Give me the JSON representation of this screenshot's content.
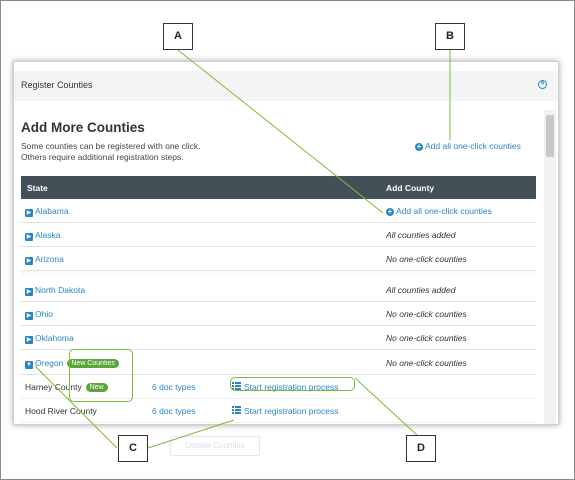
{
  "modal": {
    "title": "Register Counties",
    "close_icon": "close-circle-icon",
    "section_title": "Add More Counties",
    "desc_line1": "Some counties can be registered with one click.",
    "desc_line2": "Others require additional registration steps.",
    "add_all_label": "Add all one-click counties",
    "footer_button": "Update Counties"
  },
  "table": {
    "headers": {
      "state": "State",
      "add_county": "Add County"
    },
    "rows": [
      {
        "state": "Alabama",
        "add": "Add all one-click counties"
      },
      {
        "state": "Alaska",
        "add": "All counties added"
      },
      {
        "state": "Arizona",
        "add": "No one-click counties"
      },
      {
        "state": "North Dakota",
        "add": "All counties added"
      },
      {
        "state": "Ohio",
        "add": "No one-click counties"
      },
      {
        "state": "Oklahoma",
        "add": "No one-click counties"
      },
      {
        "state": "Oregon",
        "badge": "New Counties",
        "add": "No one-click counties"
      }
    ],
    "sub_rows": [
      {
        "county": "Harney County",
        "badge": "New",
        "doc_types": "6 doc types",
        "start": "Start registration process"
      },
      {
        "county": "Hood River County",
        "doc_types": "6 doc types",
        "start": "Start registration process"
      }
    ]
  },
  "callouts": {
    "a": "A",
    "b": "B",
    "c": "C",
    "d": "D"
  },
  "colors": {
    "link": "#2a86c3",
    "header_bg": "#435058",
    "badge": "#5aa53c",
    "highlight": "#7dbb3a"
  }
}
